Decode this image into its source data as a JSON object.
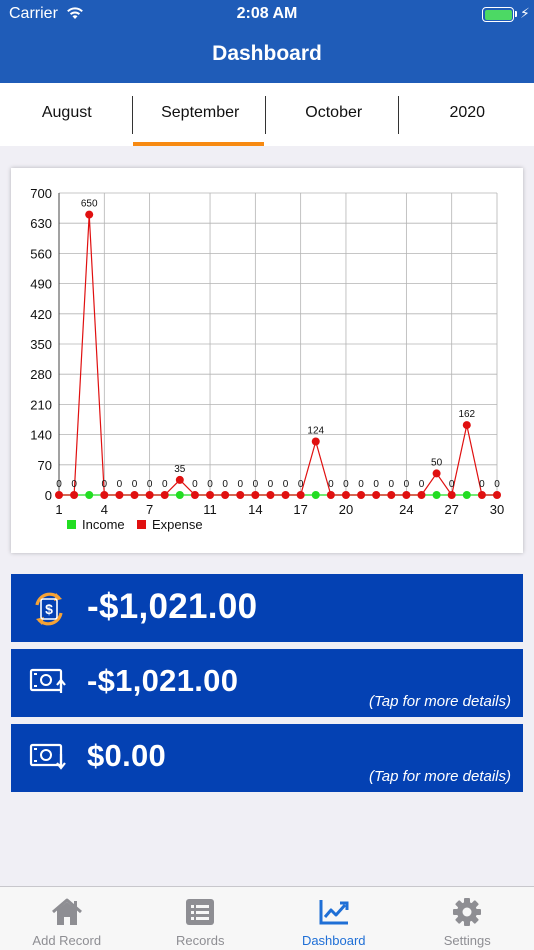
{
  "status": {
    "carrier": "Carrier",
    "time": "2:08 AM"
  },
  "nav": {
    "title": "Dashboard"
  },
  "period_tabs": [
    {
      "label": "August",
      "selected": false
    },
    {
      "label": "September",
      "selected": true
    },
    {
      "label": "October",
      "selected": false
    },
    {
      "label": "2020",
      "selected": false
    }
  ],
  "chart_data": {
    "type": "line",
    "x": [
      1,
      2,
      3,
      4,
      5,
      6,
      7,
      8,
      9,
      10,
      11,
      12,
      13,
      14,
      15,
      16,
      17,
      18,
      19,
      20,
      21,
      22,
      23,
      24,
      25,
      26,
      27,
      28,
      29,
      30
    ],
    "xticks": [
      1,
      4,
      7,
      11,
      14,
      17,
      20,
      24,
      27,
      30
    ],
    "ylim": [
      0,
      700
    ],
    "yticks": [
      0,
      70,
      140,
      210,
      280,
      350,
      420,
      490,
      560,
      630,
      700
    ],
    "grid": true,
    "legend_position": "bottom-left",
    "series": [
      {
        "name": "Income",
        "color": "#22dd22",
        "values": [
          0,
          0,
          0,
          0,
          0,
          0,
          0,
          0,
          0,
          0,
          0,
          0,
          0,
          0,
          0,
          0,
          0,
          0,
          0,
          0,
          0,
          0,
          0,
          0,
          0,
          0,
          0,
          0,
          0,
          0
        ]
      },
      {
        "name": "Expense",
        "color": "#e01010",
        "values": [
          0,
          0,
          650,
          0,
          0,
          0,
          0,
          0,
          35,
          0,
          0,
          0,
          0,
          0,
          0,
          0,
          0,
          124,
          0,
          0,
          0,
          0,
          0,
          0,
          0,
          50,
          0,
          162,
          0,
          0
        ]
      }
    ],
    "data_labels": [
      0,
      0,
      650,
      0,
      0,
      0,
      0,
      0,
      35,
      0,
      0,
      0,
      0,
      0,
      0,
      0,
      0,
      124,
      0,
      0,
      0,
      0,
      0,
      0,
      0,
      50,
      0,
      162,
      0,
      0
    ]
  },
  "summaries": {
    "balance": {
      "amount": "-$1,021.00"
    },
    "expense": {
      "amount": "-$1,021.00",
      "hint": "(Tap for more details)"
    },
    "income": {
      "amount": "$0.00",
      "hint": "(Tap for more details)"
    }
  },
  "colors": {
    "accent": "#1f5cb8",
    "card": "#0441b3",
    "indicator": "#f78a12"
  },
  "tabbar": [
    {
      "label": "Add Record",
      "icon": "home-icon",
      "active": false
    },
    {
      "label": "Records",
      "icon": "list-icon",
      "active": false
    },
    {
      "label": "Dashboard",
      "icon": "chart-icon",
      "active": true
    },
    {
      "label": "Settings",
      "icon": "gear-icon",
      "active": false
    }
  ]
}
